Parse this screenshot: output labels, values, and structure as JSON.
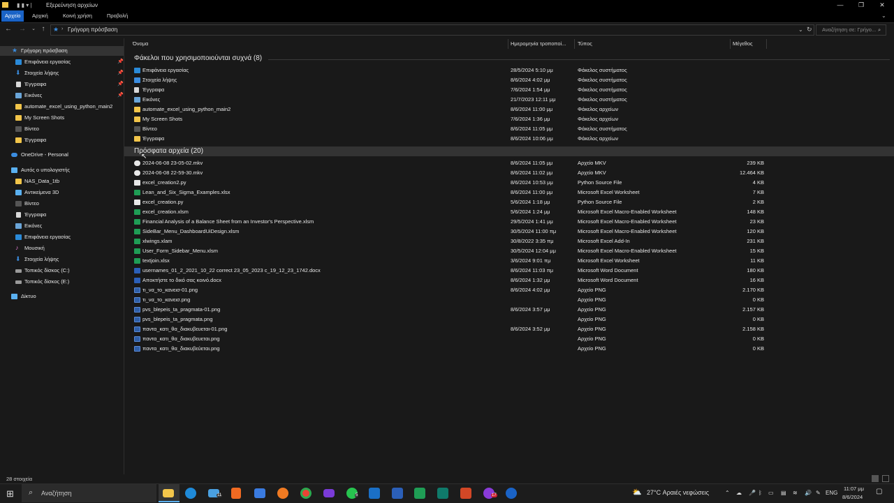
{
  "window": {
    "title": "Εξερεύνηση αρχείων"
  },
  "ribbon": {
    "tabs": [
      "Αρχείο",
      "Αρχική",
      "Κοινή χρήση",
      "Προβολή"
    ]
  },
  "address": {
    "path": "Γρήγορη πρόσβαση",
    "search_placeholder": "Αναζήτηση σε: Γρήγο..."
  },
  "sidebar": {
    "quick_access": "Γρήγορη πρόσβαση",
    "pinned": [
      "Επιφάνεια εργασίας",
      "Στοιχεία λήψης",
      "Έγγραφα",
      "Εικόνες"
    ],
    "recent": [
      "automate_excel_using_python_main2",
      "My Screen Shots",
      "Βίντεο",
      "Έγγραφα"
    ],
    "onedrive": "OneDrive - Personal",
    "this_pc": "Αυτός ο υπολογιστής",
    "pc_items": [
      "NAS_Data_1tb",
      "Αντικείμενα 3D",
      "Βίντεο",
      "Έγγραφα",
      "Εικόνες",
      "Επιφάνεια εργασίας",
      "Μουσική",
      "Στοιχεία λήψης",
      "Τοπικός δίσκος (C:)",
      "Τοπικός δίσκος (E:)"
    ],
    "network": "Δίκτυο"
  },
  "columns": {
    "name": "Όνομα",
    "date": "Ημερομηνία τροποποί...",
    "type": "Τύπος",
    "size": "Μέγεθος"
  },
  "frequent": {
    "title": "Φάκελοι που χρησιμοποιούνται συχνά (8)",
    "items": [
      {
        "name": "Επιφάνεια εργασίας",
        "date": "28/5/2024 5:10 μμ",
        "type": "Φάκελος συστήματος",
        "icon": "desktop-folder"
      },
      {
        "name": "Στοιχεία λήψης",
        "date": "8/6/2024 4:02 μμ",
        "type": "Φάκελος συστήματος",
        "icon": "downloads-folder"
      },
      {
        "name": "Έγγραφα",
        "date": "7/6/2024 1:54 μμ",
        "type": "Φάκελος συστήματος",
        "icon": "documents-folder"
      },
      {
        "name": "Εικόνες",
        "date": "21/7/2023 12:11 μμ",
        "type": "Φάκελος συστήματος",
        "icon": "pictures-folder"
      },
      {
        "name": "automate_excel_using_python_main2",
        "date": "8/6/2024 11:00 μμ",
        "type": "Φάκελος αρχείων",
        "icon": "folder"
      },
      {
        "name": "My Screen Shots",
        "date": "7/6/2024 1:36 μμ",
        "type": "Φάκελος αρχείων",
        "icon": "folder"
      },
      {
        "name": "Βίντεο",
        "date": "8/6/2024 11:05 μμ",
        "type": "Φάκελος συστήματος",
        "icon": "videos-folder"
      },
      {
        "name": "Έγγραφα",
        "date": "8/6/2024 10:06 μμ",
        "type": "Φάκελος αρχείων",
        "icon": "folder"
      }
    ]
  },
  "recent_files": {
    "title": "Πρόσφατα αρχεία (20)",
    "items": [
      {
        "name": "2024-06-08 23-05-02.mkv",
        "date": "8/6/2024 11:05 μμ",
        "type": "Αρχείο MKV",
        "size": "239 KB",
        "icon": "mkv"
      },
      {
        "name": "2024-06-08 22-59-30.mkv",
        "date": "8/6/2024 11:02 μμ",
        "type": "Αρχείο MKV",
        "size": "12.464 KB",
        "icon": "mkv"
      },
      {
        "name": "excel_creation2.py",
        "date": "8/6/2024 10:53 μμ",
        "type": "Python Source File",
        "size": "4 KB",
        "icon": "python"
      },
      {
        "name": "Lean_and_Six_Sigma_Examples.xlsx",
        "date": "8/6/2024 11:00 μμ",
        "type": "Microsoft Excel Worksheet",
        "size": "7 KB",
        "icon": "excel"
      },
      {
        "name": "excel_creation.py",
        "date": "5/6/2024 1:18 μμ",
        "type": "Python Source File",
        "size": "2 KB",
        "icon": "python"
      },
      {
        "name": "excel_creation.xlsm",
        "date": "5/6/2024 1:24 μμ",
        "type": "Microsoft Excel Macro-Enabled Worksheet",
        "size": "148 KB",
        "icon": "excel"
      },
      {
        "name": "Financial Analysis of a Balance Sheet from an Investor's Perspective.xlsm",
        "date": "29/5/2024 1:41 μμ",
        "type": "Microsoft Excel Macro-Enabled Worksheet",
        "size": "23 KB",
        "icon": "excel"
      },
      {
        "name": "SideBar_Menu_DashboardUiDesign.xlsm",
        "date": "30/5/2024 11:00 πμ",
        "type": "Microsoft Excel Macro-Enabled Worksheet",
        "size": "120 KB",
        "icon": "excel"
      },
      {
        "name": "xlwings.xlam",
        "date": "30/8/2022 3:35 πμ",
        "type": "Microsoft Excel Add-In",
        "size": "231 KB",
        "icon": "excel"
      },
      {
        "name": "User_Form_Sidebar_Menu.xlsm",
        "date": "30/5/2024 12:04 μμ",
        "type": "Microsoft Excel Macro-Enabled Worksheet",
        "size": "15 KB",
        "icon": "excel"
      },
      {
        "name": "textjoin.xlsx",
        "date": "3/6/2024 9:01 πμ",
        "type": "Microsoft Excel Worksheet",
        "size": "11 KB",
        "icon": "excel"
      },
      {
        "name": "usernames_01_2_2021_10_22 correct 23_05_2023 c_19_12_23_1742.docx",
        "date": "8/6/2024 11:03 πμ",
        "type": "Microsoft Word Document",
        "size": "180 KB",
        "icon": "word"
      },
      {
        "name": "Αποκτήστε το δικό σας κοινό.docx",
        "date": "8/6/2024 1:32 μμ",
        "type": "Microsoft Word Document",
        "size": "16 KB",
        "icon": "word"
      },
      {
        "name": "τι_να_το_κανεισ-01.png",
        "date": "8/6/2024 4:02 μμ",
        "type": "Αρχείο PNG",
        "size": "2.170 KB",
        "icon": "png"
      },
      {
        "name": "τι_να_το_κανεισ.png",
        "date": "",
        "type": "Αρχείο PNG",
        "size": "0 KB",
        "icon": "png"
      },
      {
        "name": "pvs_blepeis_ta_pragmata-01.png",
        "date": "8/6/2024 3:57 μμ",
        "type": "Αρχείο PNG",
        "size": "2.157 KB",
        "icon": "png"
      },
      {
        "name": "pvs_blepeis_ta_pragmata.png",
        "date": "",
        "type": "Αρχείο PNG",
        "size": "0 KB",
        "icon": "png"
      },
      {
        "name": "παντα_κατι_θα_διακυβευεται-01.png",
        "date": "8/6/2024 3:52 μμ",
        "type": "Αρχείο PNG",
        "size": "2.158 KB",
        "icon": "png"
      },
      {
        "name": "παντα_κατι_θα_διακυβευεται.png",
        "date": "",
        "type": "Αρχείο PNG",
        "size": "0 KB",
        "icon": "png"
      },
      {
        "name": "παντα_κατι_θα_διακυβεύεται.png",
        "date": "",
        "type": "Αρχείο PNG",
        "size": "0 KB",
        "icon": "png"
      }
    ]
  },
  "status": {
    "count": "28 στοιχεία"
  },
  "taskbar": {
    "search": "Αναζήτηση",
    "weather": "27°C Αραιές νεφώσεις",
    "lang": "ENG",
    "time": "11:07 μμ",
    "date": "8/6/2024",
    "badges": {
      "mail": "11",
      "whatsapp": "5",
      "app": "17"
    }
  },
  "colors": {
    "accent": "#1a63c6",
    "folder": "#f2c54a",
    "excel": "#1f9d55",
    "word": "#2b5fb8",
    "png": "#2f5fa8",
    "python": "#e8e8e8",
    "mkv": "#e8e8e8"
  }
}
